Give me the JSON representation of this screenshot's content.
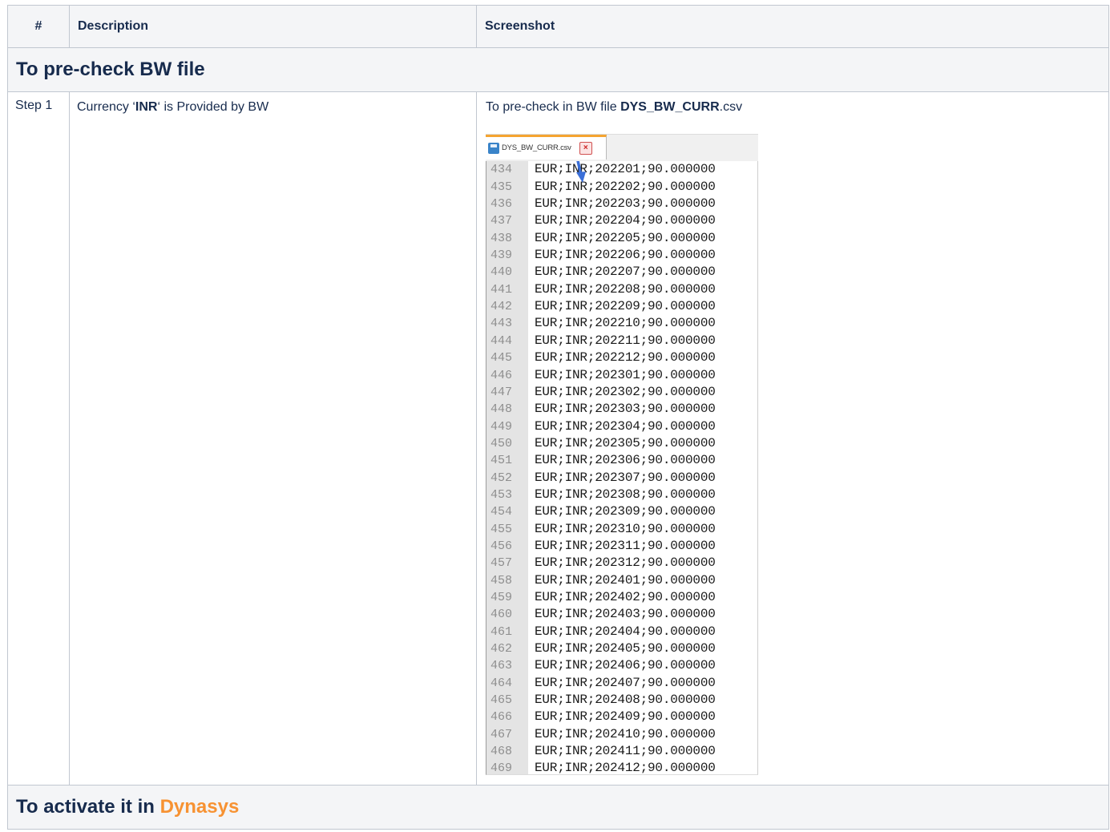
{
  "headers": {
    "num": "#",
    "description": "Description",
    "screenshot": "Screenshot"
  },
  "section1_title": "To pre-check BW file",
  "step": {
    "label": "Step 1",
    "desc_pre": "Currency ‘",
    "desc_bold": "INR",
    "desc_post": "‘ is Provided by BW",
    "shot_pre": "To pre-check in BW file ",
    "shot_bold": "DYS_BW_CURR",
    "shot_post": ".csv"
  },
  "editor": {
    "tab_name": "DYS_BW_CURR.csv",
    "close_glyph": "×",
    "lines": [
      {
        "n": "434",
        "t": "EUR;INR;202201;90.000000"
      },
      {
        "n": "435",
        "t": "EUR;INR;202202;90.000000"
      },
      {
        "n": "436",
        "t": "EUR;INR;202203;90.000000"
      },
      {
        "n": "437",
        "t": "EUR;INR;202204;90.000000"
      },
      {
        "n": "438",
        "t": "EUR;INR;202205;90.000000"
      },
      {
        "n": "439",
        "t": "EUR;INR;202206;90.000000"
      },
      {
        "n": "440",
        "t": "EUR;INR;202207;90.000000"
      },
      {
        "n": "441",
        "t": "EUR;INR;202208;90.000000"
      },
      {
        "n": "442",
        "t": "EUR;INR;202209;90.000000"
      },
      {
        "n": "443",
        "t": "EUR;INR;202210;90.000000"
      },
      {
        "n": "444",
        "t": "EUR;INR;202211;90.000000"
      },
      {
        "n": "445",
        "t": "EUR;INR;202212;90.000000"
      },
      {
        "n": "446",
        "t": "EUR;INR;202301;90.000000"
      },
      {
        "n": "447",
        "t": "EUR;INR;202302;90.000000"
      },
      {
        "n": "448",
        "t": "EUR;INR;202303;90.000000"
      },
      {
        "n": "449",
        "t": "EUR;INR;202304;90.000000"
      },
      {
        "n": "450",
        "t": "EUR;INR;202305;90.000000"
      },
      {
        "n": "451",
        "t": "EUR;INR;202306;90.000000"
      },
      {
        "n": "452",
        "t": "EUR;INR;202307;90.000000"
      },
      {
        "n": "453",
        "t": "EUR;INR;202308;90.000000"
      },
      {
        "n": "454",
        "t": "EUR;INR;202309;90.000000"
      },
      {
        "n": "455",
        "t": "EUR;INR;202310;90.000000"
      },
      {
        "n": "456",
        "t": "EUR;INR;202311;90.000000"
      },
      {
        "n": "457",
        "t": "EUR;INR;202312;90.000000"
      },
      {
        "n": "458",
        "t": "EUR;INR;202401;90.000000"
      },
      {
        "n": "459",
        "t": "EUR;INR;202402;90.000000"
      },
      {
        "n": "460",
        "t": "EUR;INR;202403;90.000000"
      },
      {
        "n": "461",
        "t": "EUR;INR;202404;90.000000"
      },
      {
        "n": "462",
        "t": "EUR;INR;202405;90.000000"
      },
      {
        "n": "463",
        "t": "EUR;INR;202406;90.000000"
      },
      {
        "n": "464",
        "t": "EUR;INR;202407;90.000000"
      },
      {
        "n": "465",
        "t": "EUR;INR;202408;90.000000"
      },
      {
        "n": "466",
        "t": "EUR;INR;202409;90.000000"
      },
      {
        "n": "467",
        "t": "EUR;INR;202410;90.000000"
      },
      {
        "n": "468",
        "t": "EUR;INR;202411;90.000000"
      },
      {
        "n": "469",
        "t": "EUR;INR;202412;90.000000"
      }
    ]
  },
  "section2": {
    "title_pre": "To activate it in ",
    "title_highlight": "Dynasys"
  },
  "colors": {
    "highlight": "#f79232",
    "tab_accent": "#f5a431",
    "arrow": "#3b6fd8",
    "border": "#c1c7d0"
  }
}
